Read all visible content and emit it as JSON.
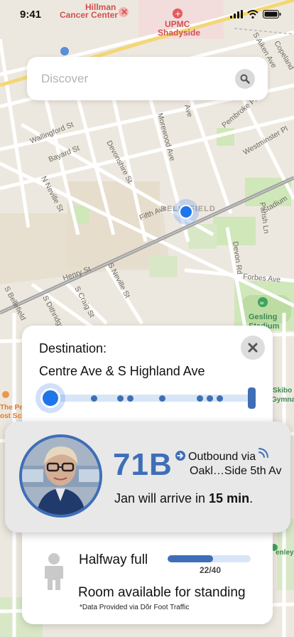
{
  "status_bar": {
    "time": "9:41",
    "icons": [
      "cellular-signal-icon",
      "wifi-icon",
      "battery-icon"
    ]
  },
  "map": {
    "poi": [
      {
        "label": "Hillman",
        "icon": "cross-icon"
      },
      {
        "label": "Cancer Center",
        "icon": "cross-icon"
      },
      {
        "label": "UPMC",
        "icon": "hospital-cross-icon"
      },
      {
        "label": "Shadyside",
        "icon": "hospital-cross-icon"
      },
      {
        "label": "Gesling",
        "icon": "stadium-icon"
      },
      {
        "label": "Stadium",
        "icon": "stadium-icon"
      }
    ],
    "streets": [
      "Wallingford St",
      "Bayard St",
      "N Neville St",
      "Devonshire St",
      "Morewood Ave",
      "Pembroke Pl",
      "Westminster Pl",
      "Fifth Ave",
      "Henry St",
      "S Craig St",
      "S Neville St",
      "S Dithridge St",
      "Devon Rd",
      "Parish Ln",
      "Forbes Ave",
      "S Aiken Ave",
      "Copeland",
      "Stadium",
      "S Bellefield",
      "Ave"
    ],
    "neighborhood": "BELLEFIELD",
    "edge_labels": {
      "left_1": "The Pe",
      "left_2": "ost Sch",
      "right_1": "Skibo",
      "right_2": "Gymna",
      "right_3": "enley"
    }
  },
  "search": {
    "placeholder": "Discover",
    "icon": "search-icon"
  },
  "destination": {
    "title": "Destination:",
    "name": "Centre Ave & S Highland Ave",
    "close_icon": "close-icon",
    "stops_count": 8
  },
  "bus": {
    "route": "71B",
    "direction_line1": "Outbound via",
    "direction_line2": "Oakl…Side 5th Av",
    "arrival_prefix": "Jan will arrive in ",
    "arrival_time": "15 min",
    "arrival_suffix": ".",
    "accent": "#3f6eb8"
  },
  "occupancy": {
    "status": "Halfway full",
    "count_text": "22/40",
    "fill_fraction": 0.55,
    "room_text": "Room available for standing",
    "note": "*Data Provided via Dŏr Foot Traffic"
  }
}
